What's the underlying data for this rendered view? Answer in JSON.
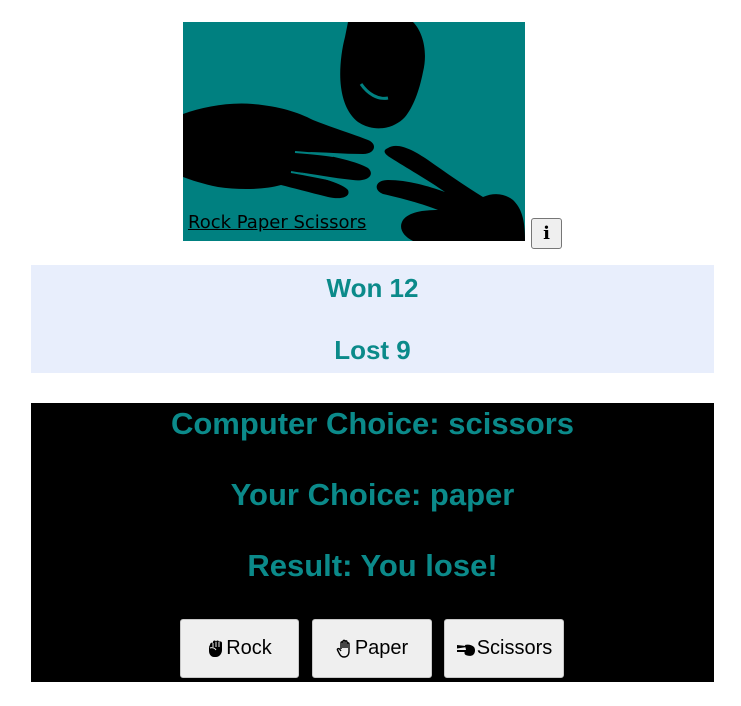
{
  "banner": {
    "caption": "Rock Paper Scissors",
    "background_color": "#008080"
  },
  "info_button": {
    "label": "i"
  },
  "score": {
    "won": "Won 12",
    "lost": "Lost 9"
  },
  "game": {
    "computer_choice": "Computer Choice: scissors",
    "your_choice": "Your Choice: paper",
    "result": "Result: You lose!"
  },
  "buttons": {
    "rock": {
      "label": "Rock",
      "icon": "fist-icon"
    },
    "paper": {
      "label": "Paper",
      "icon": "open-hand-icon"
    },
    "scissors": {
      "label": "Scissors",
      "icon": "victory-hand-icon"
    }
  },
  "colors": {
    "accent_text": "#0b8a8a",
    "score_bg": "#e8eefc",
    "game_bg": "#000000"
  }
}
